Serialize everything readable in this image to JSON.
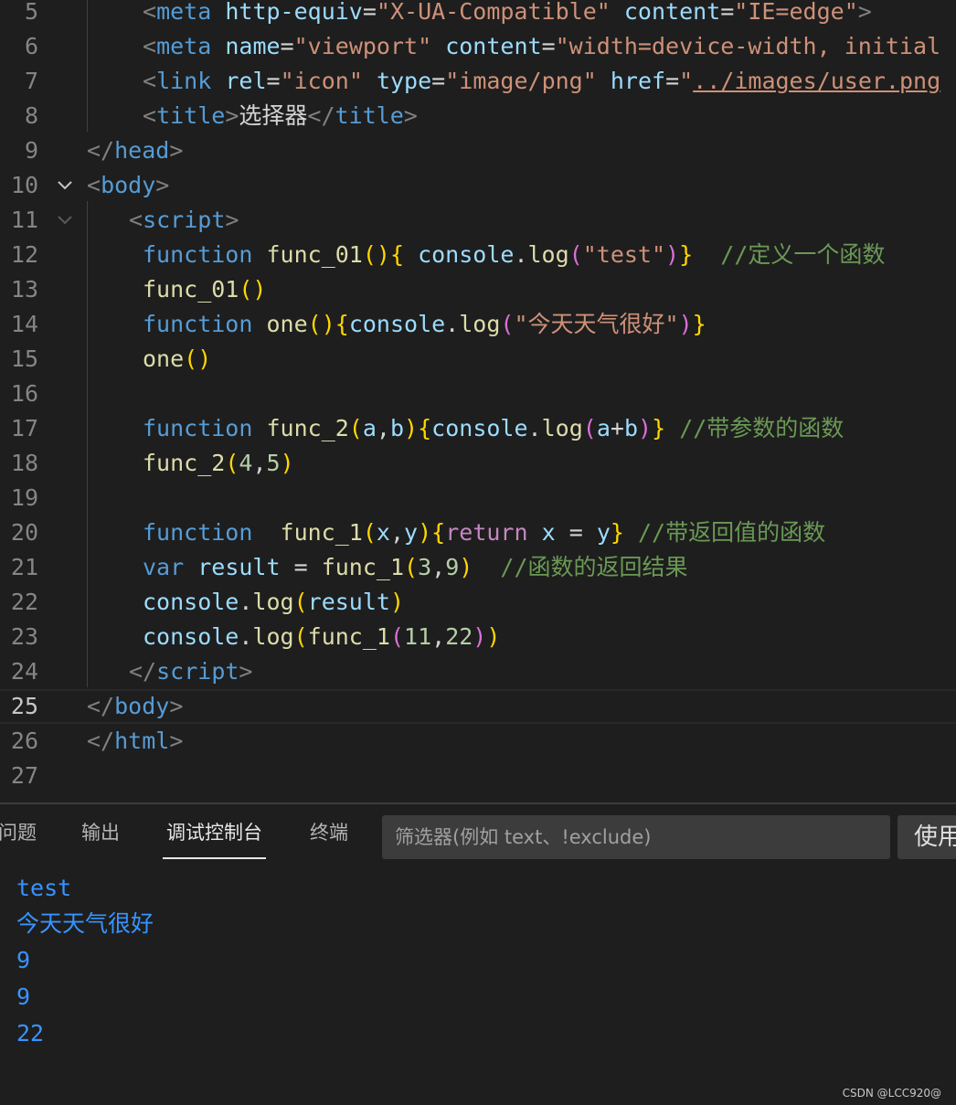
{
  "editor": {
    "active_line": "25",
    "lines": [
      {
        "num": "5",
        "tokens": [
          {
            "t": "<",
            "c": "tag"
          },
          {
            "t": "meta",
            "c": "tn"
          },
          {
            "t": " "
          },
          {
            "t": "http-equiv",
            "c": "attr"
          },
          {
            "t": "=",
            "c": "eq"
          },
          {
            "t": "\"X-UA-Compatible\"",
            "c": "str"
          },
          {
            "t": " "
          },
          {
            "t": "content",
            "c": "attr"
          },
          {
            "t": "=",
            "c": "eq"
          },
          {
            "t": "\"IE=edge\"",
            "c": "str"
          },
          {
            "t": ">",
            "c": "tag"
          }
        ]
      },
      {
        "num": "6",
        "tokens": [
          {
            "t": "<",
            "c": "tag"
          },
          {
            "t": "meta",
            "c": "tn"
          },
          {
            "t": " "
          },
          {
            "t": "name",
            "c": "attr"
          },
          {
            "t": "=",
            "c": "eq"
          },
          {
            "t": "\"viewport\"",
            "c": "str"
          },
          {
            "t": " "
          },
          {
            "t": "content",
            "c": "attr"
          },
          {
            "t": "=",
            "c": "eq"
          },
          {
            "t": "\"width=device-width, initial",
            "c": "str"
          }
        ]
      },
      {
        "num": "7",
        "tokens": [
          {
            "t": "<",
            "c": "tag"
          },
          {
            "t": "link",
            "c": "tn"
          },
          {
            "t": " "
          },
          {
            "t": "rel",
            "c": "attr"
          },
          {
            "t": "=",
            "c": "eq"
          },
          {
            "t": "\"icon\"",
            "c": "str"
          },
          {
            "t": " "
          },
          {
            "t": "type",
            "c": "attr"
          },
          {
            "t": "=",
            "c": "eq"
          },
          {
            "t": "\"image/png\"",
            "c": "str"
          },
          {
            "t": " "
          },
          {
            "t": "href",
            "c": "attr"
          },
          {
            "t": "=",
            "c": "eq"
          },
          {
            "t": "\"",
            "c": "str"
          },
          {
            "t": "../images/user.png",
            "c": "str url"
          }
        ]
      },
      {
        "num": "8",
        "tokens": [
          {
            "t": "<",
            "c": "tag"
          },
          {
            "t": "title",
            "c": "tn"
          },
          {
            "t": ">",
            "c": "tag"
          },
          {
            "t": "选择器",
            "c": "txt"
          },
          {
            "t": "</",
            "c": "tag"
          },
          {
            "t": "title",
            "c": "tn"
          },
          {
            "t": ">",
            "c": "tag"
          }
        ]
      },
      {
        "num": "9",
        "tokens": [
          {
            "t": "</",
            "c": "tag"
          },
          {
            "t": "head",
            "c": "tn"
          },
          {
            "t": ">",
            "c": "tag"
          }
        ]
      },
      {
        "num": "10",
        "tokens": [
          {
            "t": "<",
            "c": "tag"
          },
          {
            "t": "body",
            "c": "tn"
          },
          {
            "t": ">",
            "c": "tag"
          }
        ]
      },
      {
        "num": "11",
        "tokens": [
          {
            "t": "<",
            "c": "tag"
          },
          {
            "t": "script",
            "c": "tn"
          },
          {
            "t": ">",
            "c": "tag"
          }
        ]
      },
      {
        "num": "12",
        "tokens": [
          {
            "t": "function",
            "c": "kw"
          },
          {
            "t": " "
          },
          {
            "t": "func_01",
            "c": "fn"
          },
          {
            "t": "()",
            "c": "b1"
          },
          {
            "t": "{",
            "c": "b1"
          },
          {
            "t": " "
          },
          {
            "t": "console",
            "c": "var"
          },
          {
            "t": ".",
            "c": "pn"
          },
          {
            "t": "log",
            "c": "fn"
          },
          {
            "t": "(",
            "c": "b2"
          },
          {
            "t": "\"test\"",
            "c": "str"
          },
          {
            "t": ")",
            "c": "b2"
          },
          {
            "t": "}",
            "c": "b1"
          },
          {
            "t": "  "
          },
          {
            "t": "//定义一个函数",
            "c": "cmt"
          }
        ]
      },
      {
        "num": "13",
        "tokens": [
          {
            "t": "func_01",
            "c": "fn"
          },
          {
            "t": "()",
            "c": "b1"
          }
        ]
      },
      {
        "num": "14",
        "tokens": [
          {
            "t": "function",
            "c": "kw"
          },
          {
            "t": " "
          },
          {
            "t": "one",
            "c": "fn"
          },
          {
            "t": "()",
            "c": "b1"
          },
          {
            "t": "{",
            "c": "b1"
          },
          {
            "t": "console",
            "c": "var"
          },
          {
            "t": ".",
            "c": "pn"
          },
          {
            "t": "log",
            "c": "fn"
          },
          {
            "t": "(",
            "c": "b2"
          },
          {
            "t": "\"今天天气很好\"",
            "c": "str"
          },
          {
            "t": ")",
            "c": "b2"
          },
          {
            "t": "}",
            "c": "b1"
          }
        ]
      },
      {
        "num": "15",
        "tokens": [
          {
            "t": "one",
            "c": "fn"
          },
          {
            "t": "()",
            "c": "b1"
          }
        ]
      },
      {
        "num": "16",
        "tokens": []
      },
      {
        "num": "17",
        "tokens": [
          {
            "t": "function",
            "c": "kw"
          },
          {
            "t": " "
          },
          {
            "t": "func_2",
            "c": "fn"
          },
          {
            "t": "(",
            "c": "b1"
          },
          {
            "t": "a",
            "c": "var"
          },
          {
            "t": ",",
            "c": "pn"
          },
          {
            "t": "b",
            "c": "var"
          },
          {
            "t": ")",
            "c": "b1"
          },
          {
            "t": "{",
            "c": "b1"
          },
          {
            "t": "console",
            "c": "var"
          },
          {
            "t": ".",
            "c": "pn"
          },
          {
            "t": "log",
            "c": "fn"
          },
          {
            "t": "(",
            "c": "b2"
          },
          {
            "t": "a",
            "c": "var"
          },
          {
            "t": "+",
            "c": "pn"
          },
          {
            "t": "b",
            "c": "var"
          },
          {
            "t": ")",
            "c": "b2"
          },
          {
            "t": "}",
            "c": "b1"
          },
          {
            "t": " "
          },
          {
            "t": "//带参数的函数",
            "c": "cmt"
          }
        ]
      },
      {
        "num": "18",
        "tokens": [
          {
            "t": "func_2",
            "c": "fn"
          },
          {
            "t": "(",
            "c": "b1"
          },
          {
            "t": "4",
            "c": "num"
          },
          {
            "t": ",",
            "c": "pn"
          },
          {
            "t": "5",
            "c": "num"
          },
          {
            "t": ")",
            "c": "b1"
          }
        ]
      },
      {
        "num": "19",
        "tokens": []
      },
      {
        "num": "20",
        "tokens": [
          {
            "t": "function",
            "c": "kw"
          },
          {
            "t": "  "
          },
          {
            "t": "func_1",
            "c": "fn"
          },
          {
            "t": "(",
            "c": "b1"
          },
          {
            "t": "x",
            "c": "var"
          },
          {
            "t": ",",
            "c": "pn"
          },
          {
            "t": "y",
            "c": "var"
          },
          {
            "t": ")",
            "c": "b1"
          },
          {
            "t": "{",
            "c": "b1"
          },
          {
            "t": "return",
            "c": "ctl"
          },
          {
            "t": " "
          },
          {
            "t": "x",
            "c": "var"
          },
          {
            "t": " = ",
            "c": "pn"
          },
          {
            "t": "y",
            "c": "var"
          },
          {
            "t": "}",
            "c": "b1"
          },
          {
            "t": " "
          },
          {
            "t": "//带返回值的函数",
            "c": "cmt"
          }
        ]
      },
      {
        "num": "21",
        "tokens": [
          {
            "t": "var",
            "c": "kw"
          },
          {
            "t": " "
          },
          {
            "t": "result",
            "c": "var"
          },
          {
            "t": " = ",
            "c": "pn"
          },
          {
            "t": "func_1",
            "c": "fn"
          },
          {
            "t": "(",
            "c": "b1"
          },
          {
            "t": "3",
            "c": "num"
          },
          {
            "t": ",",
            "c": "pn"
          },
          {
            "t": "9",
            "c": "num"
          },
          {
            "t": ")",
            "c": "b1"
          },
          {
            "t": "  "
          },
          {
            "t": "//函数的返回结果",
            "c": "cmt"
          }
        ]
      },
      {
        "num": "22",
        "tokens": [
          {
            "t": "console",
            "c": "var"
          },
          {
            "t": ".",
            "c": "pn"
          },
          {
            "t": "log",
            "c": "fn"
          },
          {
            "t": "(",
            "c": "b1"
          },
          {
            "t": "result",
            "c": "var"
          },
          {
            "t": ")",
            "c": "b1"
          }
        ]
      },
      {
        "num": "23",
        "tokens": [
          {
            "t": "console",
            "c": "var"
          },
          {
            "t": ".",
            "c": "pn"
          },
          {
            "t": "log",
            "c": "fn"
          },
          {
            "t": "(",
            "c": "b1"
          },
          {
            "t": "func_1",
            "c": "fn"
          },
          {
            "t": "(",
            "c": "b2"
          },
          {
            "t": "11",
            "c": "num"
          },
          {
            "t": ",",
            "c": "pn"
          },
          {
            "t": "22",
            "c": "num"
          },
          {
            "t": ")",
            "c": "b2"
          },
          {
            "t": ")",
            "c": "b1"
          }
        ]
      },
      {
        "num": "24",
        "tokens": [
          {
            "t": "</",
            "c": "tag"
          },
          {
            "t": "script",
            "c": "tn"
          },
          {
            "t": ">",
            "c": "tag"
          }
        ]
      },
      {
        "num": "25",
        "tokens": [
          {
            "t": "</",
            "c": "tag"
          },
          {
            "t": "body",
            "c": "tn"
          },
          {
            "t": ">",
            "c": "tag"
          }
        ]
      },
      {
        "num": "26",
        "tokens": [
          {
            "t": "</",
            "c": "tag"
          },
          {
            "t": "html",
            "c": "tn"
          },
          {
            "t": ">",
            "c": "tag"
          }
        ]
      },
      {
        "num": "27",
        "tokens": []
      }
    ]
  },
  "panel": {
    "tabs": [
      {
        "label": "问题",
        "active": false
      },
      {
        "label": "输出",
        "active": false
      },
      {
        "label": "调试控制台",
        "active": true
      },
      {
        "label": "终端",
        "active": false
      }
    ],
    "filter": {
      "value": "",
      "placeholder": "筛选器(例如 text、!exclude)"
    },
    "use_button_label": "使用",
    "output": [
      "test",
      "今天天气很好",
      "9",
      "9",
      "22"
    ]
  },
  "watermark": "CSDN @LCC920@"
}
